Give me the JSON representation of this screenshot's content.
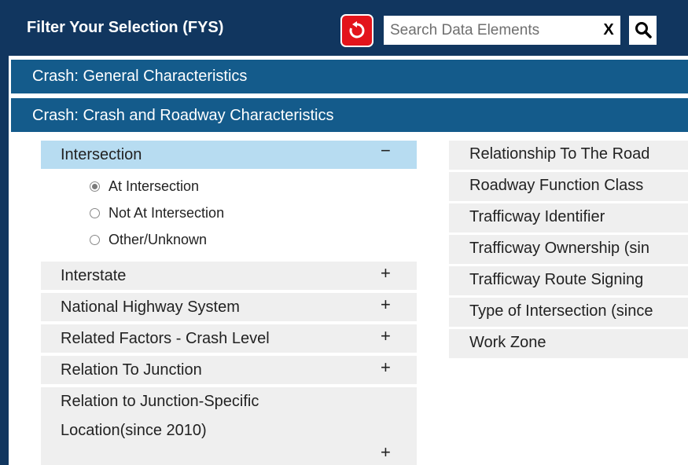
{
  "header": {
    "title": "Filter Your Selection (FYS)",
    "search_placeholder": "Search Data Elements",
    "clear_label": "X"
  },
  "sections": [
    {
      "label": "Crash: General Characteristics"
    },
    {
      "label": "Crash: Crash and Roadway Characteristics"
    }
  ],
  "left_items": [
    {
      "label": "Intersection",
      "sign": "−",
      "expanded": true
    },
    {
      "label": "Interstate",
      "sign": "+"
    },
    {
      "label": "National Highway System",
      "sign": "+"
    },
    {
      "label": "Related Factors - Crash Level",
      "sign": "+"
    },
    {
      "label": "Relation To Junction",
      "sign": "+"
    },
    {
      "label": "Relation to Junction-Specific Location(since 2010)",
      "sign": "+"
    }
  ],
  "intersection_options": [
    {
      "label": "At Intersection",
      "selected": true
    },
    {
      "label": "Not At Intersection",
      "selected": false
    },
    {
      "label": "Other/Unknown",
      "selected": false
    }
  ],
  "right_items": [
    {
      "label": "Relationship To The Road"
    },
    {
      "label": "Roadway Function Class"
    },
    {
      "label": "Trafficway Identifier"
    },
    {
      "label": "Trafficway Ownership (sin"
    },
    {
      "label": "Trafficway Route Signing"
    },
    {
      "label": "Type of Intersection (since"
    },
    {
      "label": "Work Zone"
    }
  ],
  "colors": {
    "header_bg": "#11365f",
    "section_bg": "#145b8b",
    "active_item_bg": "#b7dcf1",
    "item_bg": "#efefef",
    "reset_button": "#e3141b"
  }
}
